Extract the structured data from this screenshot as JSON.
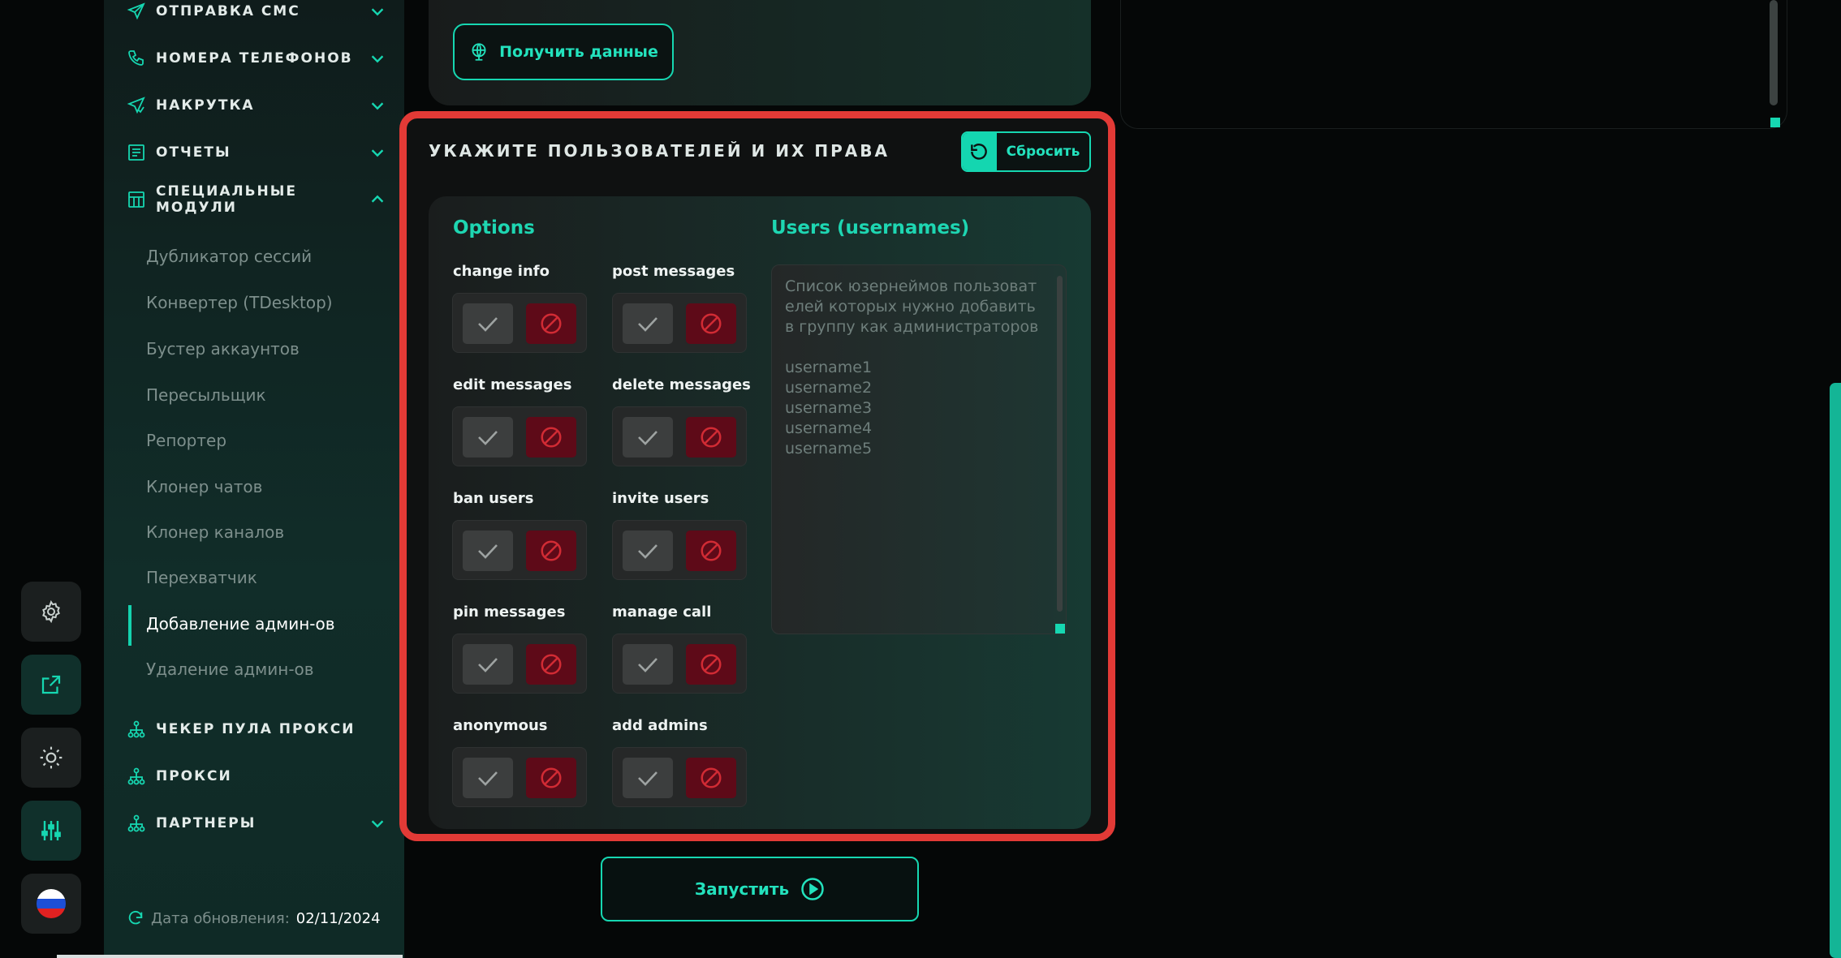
{
  "sidebar": {
    "items": [
      {
        "label": "ОТПРАВКА СМС"
      },
      {
        "label": "НОМЕРА ТЕЛЕФОНОВ"
      },
      {
        "label": "НАКРУТКА"
      },
      {
        "label": "ОТЧЕТЫ"
      },
      {
        "label": "СПЕЦИАЛЬНЫЕ МОДУЛИ"
      },
      {
        "label": "ЧЕКЕР ПУЛА ПРОКСИ"
      },
      {
        "label": "ПРОКСИ"
      },
      {
        "label": "ПАРТНЕРЫ"
      }
    ],
    "sub_items": [
      "Дубликатор сессий",
      "Конвертер (TDesktop)",
      "Бустер аккаунтов",
      "Пересыльщик",
      "Репортер",
      "Клонер чатов",
      "Клонер каналов",
      "Перехватчик",
      "Добавление админ-ов",
      "Удаление админ-ов"
    ],
    "active_sub_item": "Добавление админ-ов",
    "update_label": "Дата обновления:",
    "update_date": "02/11/2024"
  },
  "rail": {
    "icons": [
      "gear-icon",
      "external-link-icon",
      "sun-icon",
      "sliders-icon",
      "russia-flag-icon"
    ]
  },
  "top_card": {
    "get_data_label": "Получить данные"
  },
  "perm_card": {
    "title": "УКАЖИТЕ ПОЛЬЗОВАТЕЛЕЙ И ИХ ПРАВА",
    "reset_label": "Сбросить",
    "options_title": "Options",
    "users_title": "Users (usernames)",
    "options": [
      {
        "label": "change info"
      },
      {
        "label": "post messages"
      },
      {
        "label": "edit messages"
      },
      {
        "label": "delete messages"
      },
      {
        "label": "ban users"
      },
      {
        "label": "invite users"
      },
      {
        "label": "pin messages"
      },
      {
        "label": "manage call"
      },
      {
        "label": "anonymous"
      },
      {
        "label": "add admins"
      }
    ],
    "users_placeholder": "Список юзернеймов пользователей которых нужно добавить в группу как администраторов\n\nusername1\nusername2\nusername3\nusername4\nusername5"
  },
  "run_label": "Запустить",
  "colors": {
    "accent": "#16d7b1",
    "danger": "#5e0a18",
    "highlight": "#e23a36"
  }
}
